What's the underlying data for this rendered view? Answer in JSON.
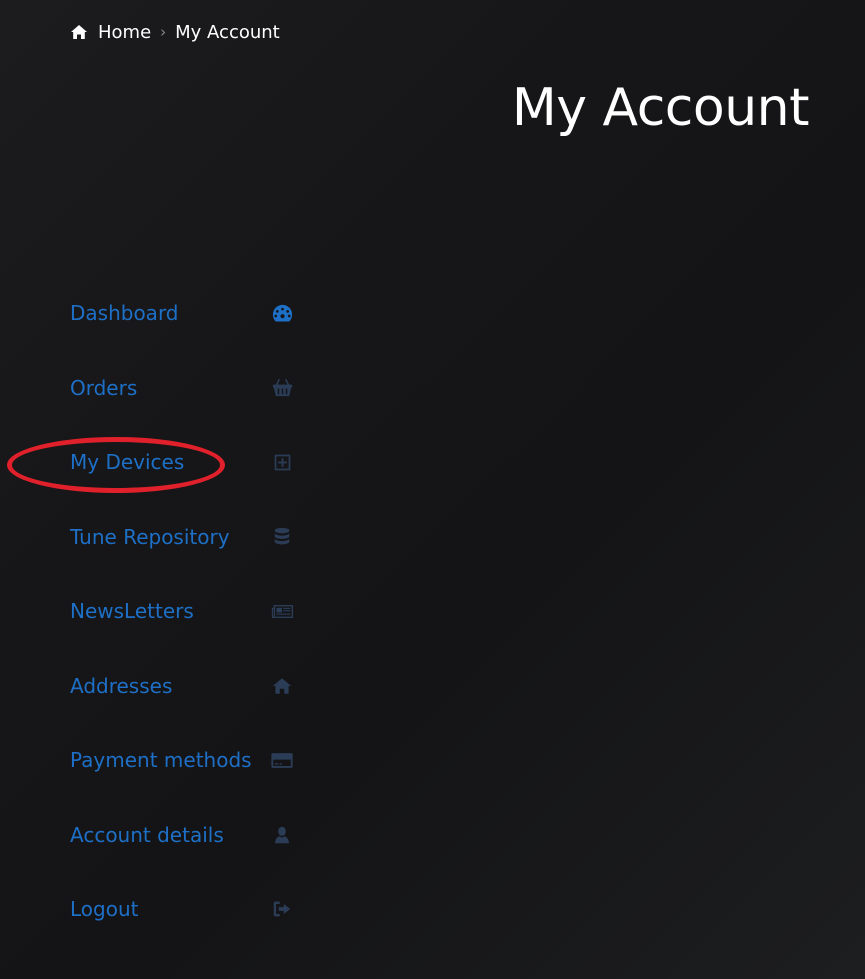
{
  "breadcrumb": {
    "home_icon": "home-icon",
    "home_label": "Home",
    "separator": "›",
    "current_label": "My Account"
  },
  "page": {
    "title": "My Account"
  },
  "colors": {
    "link": "#1e6fc6",
    "icon_dim": "#2b3c57",
    "annotation": "#e0202a",
    "text": "#ffffff"
  },
  "nav": {
    "items": [
      {
        "label": "Dashboard",
        "icon": "dashboard-gauge-icon"
      },
      {
        "label": "Orders",
        "icon": "basket-icon"
      },
      {
        "label": "My Devices",
        "icon": "plus-square-icon"
      },
      {
        "label": "Tune Repository",
        "icon": "database-icon"
      },
      {
        "label": "NewsLetters",
        "icon": "newspaper-icon"
      },
      {
        "label": "Addresses",
        "icon": "home-icon"
      },
      {
        "label": "Payment methods",
        "icon": "credit-card-icon"
      },
      {
        "label": "Account details",
        "icon": "user-icon"
      },
      {
        "label": "Logout",
        "icon": "sign-out-icon"
      }
    ]
  }
}
